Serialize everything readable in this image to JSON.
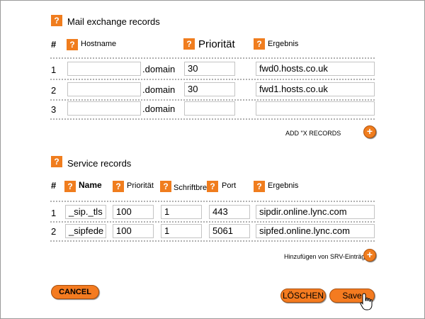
{
  "icons": {
    "help": "help-icon",
    "add": "plus-circle-icon",
    "cursor": "hand-cursor-icon"
  },
  "colors": {
    "accent": "#f07d1e",
    "input_border": "#c4c4c4",
    "dotted_rule": "#b0b0b0"
  },
  "mx": {
    "title": "Mail exchange records",
    "col_num": "#",
    "col_hostname": "Hostname",
    "col_priority": "Priorität",
    "col_result": "Ergebnis",
    "rows": [
      {
        "num": "1",
        "hostname": "",
        "suffix": ".domain",
        "priority": "30",
        "result": "fwd0.hosts.co.uk"
      },
      {
        "num": "2",
        "hostname": "",
        "suffix": ".domain",
        "priority": "30",
        "result": "fwd1.hosts.co.uk"
      },
      {
        "num": "3",
        "hostname": "",
        "suffix": ".domain",
        "priority": "",
        "result": ""
      }
    ],
    "add_label": "ADD \"X RECORDS"
  },
  "srv": {
    "title": "Service records",
    "col_num": "#",
    "col_name": "Name",
    "col_priority": "Priorität",
    "col_weight": "Schriftbreite",
    "col_port": "Port",
    "col_result": "Ergebnis",
    "rows": [
      {
        "num": "1",
        "name": "_sip._tls",
        "priority": "100",
        "weight": "1",
        "port": "443",
        "result": "sipdir.online.lync.com"
      },
      {
        "num": "2",
        "name": "_sipfede",
        "priority": "100",
        "weight": "1",
        "port": "5061",
        "result": "sipfed.online.lync.com"
      }
    ],
    "add_label": "Hinzufügen von SRV-Einträge"
  },
  "buttons": {
    "cancel": "CANCEL",
    "delete": "LÖSCHEN",
    "save": "Save"
  }
}
